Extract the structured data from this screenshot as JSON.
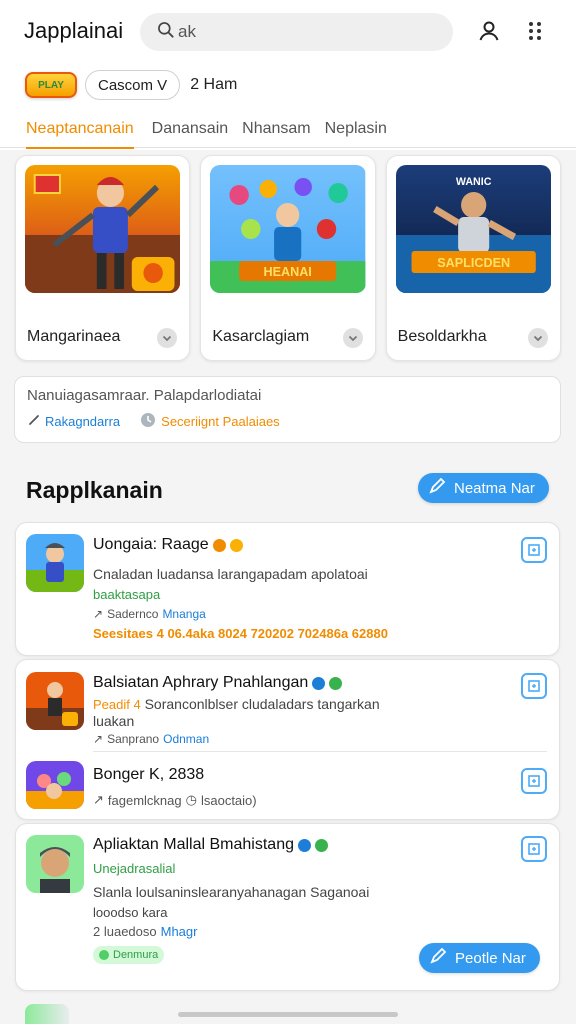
{
  "header": {
    "app_title": "Japplainai",
    "search_placeholder": "ak",
    "play_badge_text": "PLAY",
    "filter_chip": "Cascom V",
    "filter_text": "2 Ham"
  },
  "tabs": [
    "Neaptancanain",
    "Danansain",
    "Nhansam",
    "Neplasin"
  ],
  "featured": [
    {
      "name": "Mangarinaea",
      "art": "hero"
    },
    {
      "name": "Kasarclagiam",
      "art": "team",
      "art_text": "HEANAI"
    },
    {
      "name": "Besoldarkha",
      "art": "arena",
      "art_text": "SAPLICDEN",
      "art_top": "WANIC"
    }
  ],
  "info": {
    "text": "Nanuiagasamraar. Palapdarlodiatai",
    "link1": "Rakagndarra",
    "link2": "Seceriignt Paalaiaes"
  },
  "section": {
    "title": "Rapplkanain",
    "button": "Neatma Nar"
  },
  "apps": [
    {
      "name": "Uongaia: Raage",
      "desc": "Cnaladan luadansa larangapadam apolatoai",
      "green": "baaktasapa",
      "meta1": "Sadernco",
      "meta2": "Mnanga",
      "stats": "Seesitaes 4 06.4aka 8024 720202 702486a 62880"
    },
    {
      "name": "Balsiatan Aphrary Pnahlangan",
      "desc_orange": "Peadif 4",
      "desc": "Soranconlblser cludaladars tangarkan",
      "desc2": "luakan",
      "meta1": "Sanprano",
      "meta2": "Odnman"
    },
    {
      "name": "Bonger K, 2838",
      "meta1": "fagemlcknag",
      "meta2": "lsaoctaio)"
    },
    {
      "name": "Apliaktan Mallal Bmahistang",
      "green": "Unejadrasalial",
      "desc": "Slanla loulsaninslearanyahanagan Saganoai",
      "desc2": "looodso kara",
      "meta1": "2 luaedoso",
      "meta2": "Mhagr",
      "tag": "Denmura",
      "button": "Peotle Nar"
    }
  ],
  "colors": {
    "accent_orange": "#f08c00",
    "accent_blue": "#339af0",
    "green": "#2f9e44"
  }
}
